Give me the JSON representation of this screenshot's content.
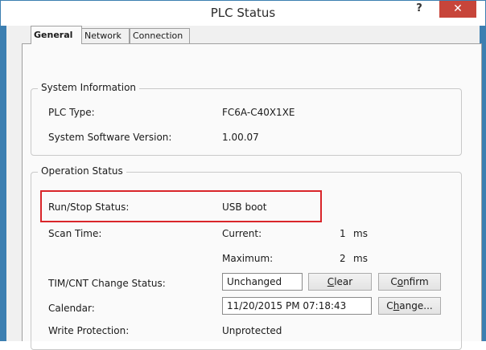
{
  "window": {
    "title": "PLC Status",
    "help_glyph": "?",
    "close_glyph": "✕"
  },
  "tabs": [
    {
      "label": "General",
      "active": true
    },
    {
      "label": "Network",
      "active": false
    },
    {
      "label": "Connection",
      "active": false
    }
  ],
  "system_info": {
    "legend": "System Information",
    "plc_type_label": "PLC Type:",
    "plc_type_value": "FC6A-C40X1XE",
    "sys_version_label": "System Software Version:",
    "sys_version_value": "1.00.07"
  },
  "operation_status": {
    "legend": "Operation Status",
    "run_stop_label": "Run/Stop Status:",
    "run_stop_value": "USB boot",
    "scan_time_label": "Scan Time:",
    "current_label": "Current:",
    "current_value": "1",
    "current_unit": "ms",
    "maximum_label": "Maximum:",
    "maximum_value": "2",
    "maximum_unit": "ms",
    "timcnt_label": "TIM/CNT Change Status:",
    "timcnt_value": "Unchanged",
    "clear_button_pre": "",
    "clear_button_ul": "C",
    "clear_button_post": "lear",
    "confirm_button_pre": "C",
    "confirm_button_ul": "o",
    "confirm_button_post": "nfirm",
    "calendar_label": "Calendar:",
    "calendar_value": "11/20/2015 PM 07:18:43",
    "change_button_pre": "C",
    "change_button_ul": "h",
    "change_button_post": "ange...",
    "write_protection_label": "Write Protection:",
    "write_protection_value": "Unprotected"
  },
  "colors": {
    "title_bar_accent": "#3c7fb1",
    "close_button": "#c7453a",
    "highlight_box": "#d9252a"
  }
}
